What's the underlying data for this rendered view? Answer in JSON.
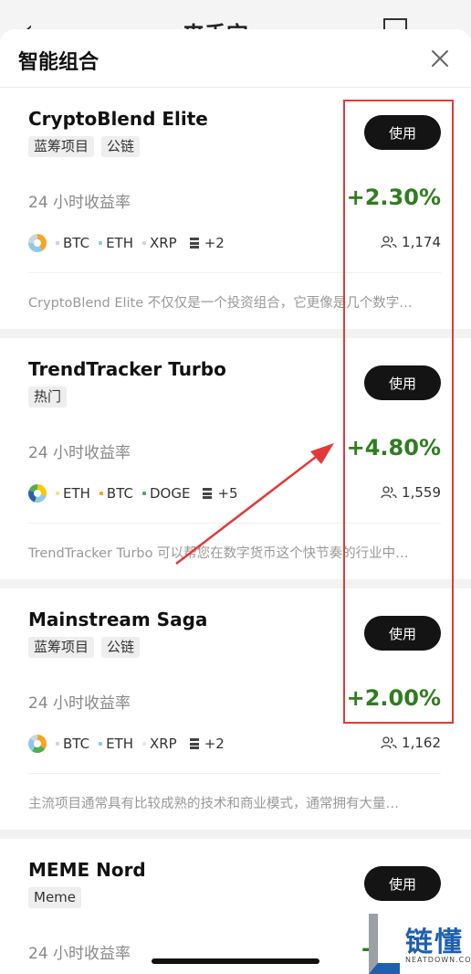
{
  "background": {
    "back_icon": "back-arrow",
    "title": "来手宝",
    "book_icon": "book-icon"
  },
  "sheet": {
    "title": "智能组合",
    "close_icon": "close-icon"
  },
  "labels": {
    "use": "使用",
    "yield_label": "24 小时收益率"
  },
  "colors": {
    "positive": "#2f7d1f",
    "button": "#141414",
    "highlight": "#e23a3a"
  },
  "cards": [
    {
      "name": "CryptoBlend Elite",
      "tags": [
        "蓝筹项目",
        "公链"
      ],
      "yield": "+2.30%",
      "coins": [
        "BTC",
        "ETH",
        "XRP"
      ],
      "more": "+2",
      "users": "1,174",
      "description": "CryptoBlend Elite 不仅仅是一个投资组合，它更像是几个数字…"
    },
    {
      "name": "TrendTracker Turbo",
      "tags": [
        "热门"
      ],
      "yield": "+4.80%",
      "coins": [
        "ETH",
        "BTC",
        "DOGE"
      ],
      "more": "+5",
      "users": "1,559",
      "description": "TrendTracker Turbo 可以帮您在数字货币这个快节奏的行业中…"
    },
    {
      "name": "Mainstream Saga",
      "tags": [
        "蓝筹项目",
        "公链"
      ],
      "yield": "+2.00%",
      "coins": [
        "BTC",
        "ETH",
        "XRP"
      ],
      "more": "+2",
      "users": "1,162",
      "description": "主流项目通常具有比较成熟的技术和商业模式，通常拥有大量…"
    },
    {
      "name": "MEME Nord",
      "tags": [
        "Meme"
      ],
      "yield": "-",
      "yield_label_visible": true
    }
  ],
  "watermark": {
    "text": "链懂",
    "sub": "NEATDOWN.COM"
  }
}
